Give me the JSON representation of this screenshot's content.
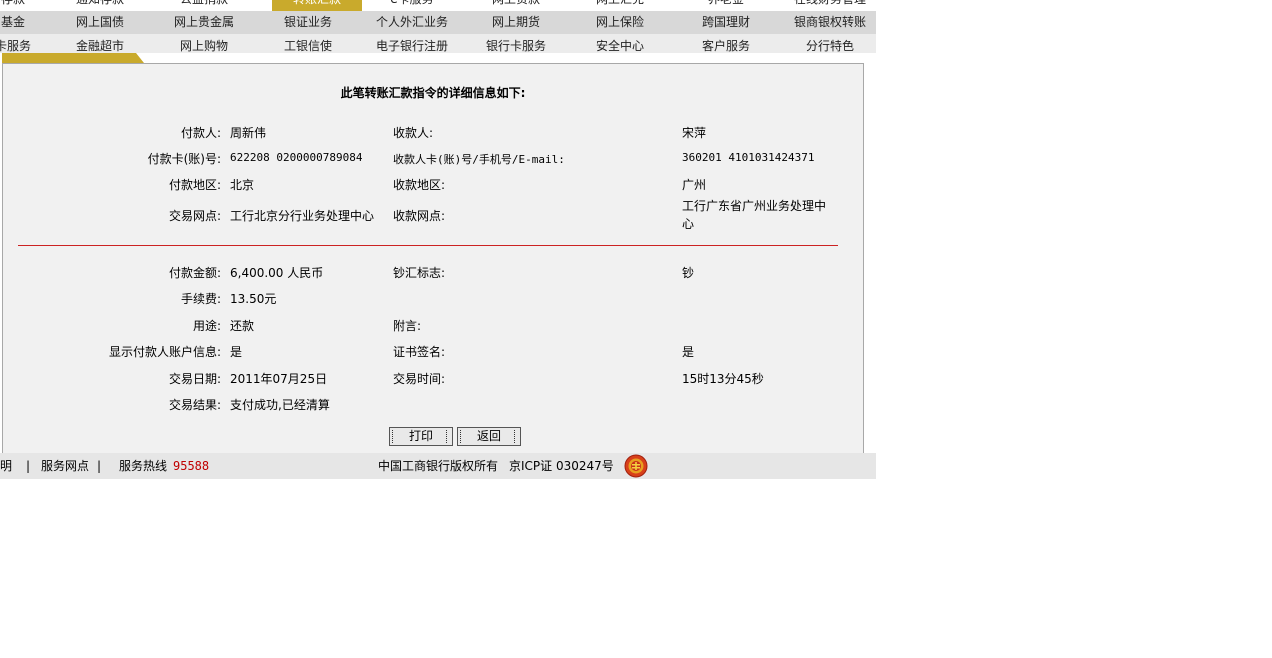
{
  "nav": {
    "row0": [
      "存款",
      "通知存款",
      "公益捐款",
      "转账汇款",
      "e卡服务",
      "网上贵款",
      "网上汇兑",
      "养老金",
      "在线财务管理"
    ],
    "row1": [
      "基金",
      "网上国债",
      "网上贵金属",
      "银证业务",
      "个人外汇业务",
      "网上期货",
      "网上保险",
      "跨国理财",
      "银商银权转账"
    ],
    "row2": [
      "卡服务",
      "金融超市",
      "网上购物",
      "工银信使",
      "电子银行注册",
      "银行卡服务",
      "安全中心",
      "客户服务",
      "分行特色"
    ]
  },
  "panel": {
    "title": "此笔转账汇款指令的详细信息如下:",
    "payer_label": "付款人:",
    "payer_value": "周新伟",
    "payee_label": "收款人:",
    "payee_value": "宋萍",
    "payer_card_label": "付款卡(账)号:",
    "payer_card_value": "622208 0200000789084",
    "payee_card_label": "收款人卡(账)号/手机号/E-mail:",
    "payee_card_value": "360201 4101031424371",
    "payer_region_label": "付款地区:",
    "payer_region_value": "北京",
    "payee_region_label": "收款地区:",
    "payee_region_value": "广州",
    "payer_branch_label": "交易网点:",
    "payer_branch_value": "工行北京分行业务处理中心",
    "payee_branch_label": "收款网点:",
    "payee_branch_value": "工行广东省广州业务处理中心",
    "amount_label": "付款金额:",
    "amount_value": "6,400.00 人民币",
    "cash_flag_label": "钞汇标志:",
    "cash_flag_value": "钞",
    "fee_label": "手续费:",
    "fee_value": "13.50元",
    "purpose_label": "用途:",
    "purpose_value": "还款",
    "note_label": "附言:",
    "note_value": "",
    "show_info_label": "显示付款人账户信息:",
    "show_info_value": "是",
    "cert_sign_label": "证书签名:",
    "cert_sign_value": "是",
    "date_label": "交易日期:",
    "date_value": "2011年07月25日",
    "time_label": "交易时间:",
    "time_value": "15时13分45秒",
    "result_label": "交易结果:",
    "result_value": "支付成功,已经清算",
    "print_button": "打印",
    "back_button": "返回"
  },
  "footer": {
    "statement": "声明",
    "sep1": "|",
    "service_points": "服务网点",
    "sep2": "|",
    "hotline_label": "服务热线",
    "hotline_number": "95588",
    "copyright": "中国工商银行版权所有",
    "icp": "京ICP证 030247号"
  },
  "colors": {
    "active_tab": "#c9aa2c",
    "divider": "#cc2222",
    "hotline": "#c00000"
  }
}
